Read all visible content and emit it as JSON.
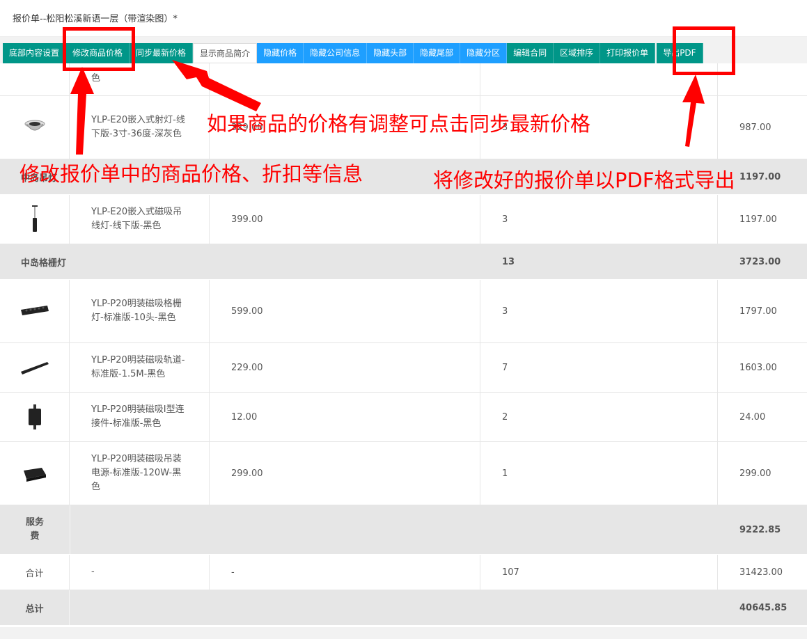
{
  "page": {
    "title": "报价单--松阳松溪新语一层（带渲染图）*"
  },
  "toolbar": [
    {
      "label": "底部内容设置",
      "style": "green",
      "name": "bottom-content-settings-button"
    },
    {
      "label": "修改商品价格",
      "style": "green",
      "name": "modify-price-button"
    },
    {
      "label": "同步最新价格",
      "style": "green",
      "name": "sync-price-button"
    },
    {
      "label": "显示商品简介",
      "style": "white",
      "name": "show-intro-button"
    },
    {
      "label": "隐藏价格",
      "style": "blue",
      "name": "hide-price-button"
    },
    {
      "label": "隐藏公司信息",
      "style": "blue",
      "name": "hide-company-button"
    },
    {
      "label": "隐藏头部",
      "style": "blue",
      "name": "hide-header-button"
    },
    {
      "label": "隐藏尾部",
      "style": "blue",
      "name": "hide-footer-button"
    },
    {
      "label": "隐藏分区",
      "style": "blue",
      "name": "hide-section-button"
    },
    {
      "label": "编辑合同",
      "style": "green",
      "name": "edit-contract-button"
    },
    {
      "label": "区域排序",
      "style": "green",
      "name": "area-sort-button"
    },
    {
      "label": "打印报价单",
      "style": "green",
      "name": "print-quote-button"
    },
    {
      "label": "导出PDF",
      "style": "green",
      "name": "export-pdf-button"
    }
  ],
  "table": {
    "partial_top": {
      "name_tail": "色"
    },
    "item1": {
      "name": "YLP-E20嵌入式射灯-线下版-3寸-36度-深灰色",
      "price": "329.00",
      "qty": "3",
      "total": "987.00",
      "icon": "downlight-icon"
    },
    "group1": {
      "name": "中岛吊灯",
      "total": "1197.00"
    },
    "item2": {
      "name": "YLP-E20嵌入式磁吸吊线灯-线下版-黑色",
      "price": "399.00",
      "qty": "3",
      "total": "1197.00",
      "icon": "pendant-icon"
    },
    "group2": {
      "name": "中岛格栅灯",
      "qty": "13",
      "total": "3723.00"
    },
    "item3": {
      "name": "YLP-P20明装磁吸格栅灯-标准版-10头-黑色",
      "price": "599.00",
      "qty": "3",
      "total": "1797.00",
      "icon": "grille-light-icon"
    },
    "item4": {
      "name": "YLP-P20明装磁吸轨道-标准版-1.5M-黑色",
      "price": "229.00",
      "qty": "7",
      "total": "1603.00",
      "icon": "track-icon"
    },
    "item5": {
      "name": "YLP-P20明装磁吸I型连接件-标准版-黑色",
      "price": "12.00",
      "qty": "2",
      "total": "24.00",
      "icon": "connector-icon"
    },
    "item6": {
      "name": "YLP-P20明装磁吸吊装电源-标准版-120W-黑色",
      "price": "299.00",
      "qty": "1",
      "total": "299.00",
      "icon": "power-supply-icon"
    },
    "service": {
      "label": "服务费",
      "total": "9222.85"
    },
    "subtotal": {
      "label": "合计",
      "name": "-",
      "price": "-",
      "qty": "107",
      "total": "31423.00"
    },
    "grand": {
      "label": "总计",
      "total": "40645.85"
    }
  },
  "annotations": {
    "sync_hint": "如果商品的价格有调整可点击同步最新价格",
    "modify_hint": "修改报价单中的商品价格、折扣等信息",
    "export_hint": "将修改好的报价单以PDF格式导出"
  },
  "colors": {
    "green": "#009688",
    "blue": "#1e9fff",
    "annotation": "#ff0000",
    "group_bg": "#e6e6e6"
  }
}
